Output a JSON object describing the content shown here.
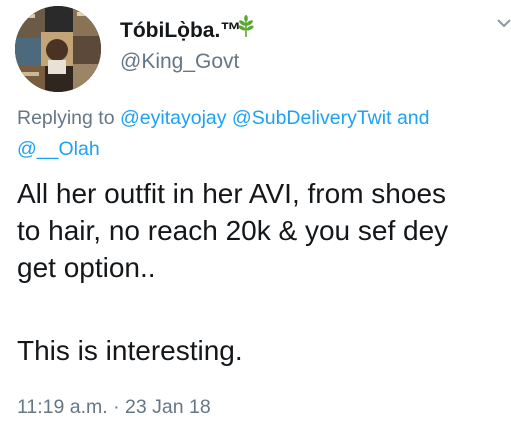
{
  "author": {
    "display_name": "TóbiLọ̀ba.™",
    "handle": "@King_Govt",
    "name_icon": "leaf-icon"
  },
  "reply": {
    "prefix": "Replying to",
    "mentions": [
      "@eyitayojay",
      "@SubDeliveryTwit",
      "@__Olah"
    ],
    "conjunction": "and"
  },
  "tweet": {
    "lines": [
      "All her outfit in her AVI, from shoes",
      "to hair, no reach 20k & you sef dey",
      "get option..",
      "This is interesting."
    ]
  },
  "meta": {
    "time": "11:19 a.m.",
    "separator": "·",
    "date": "23 Jan 18"
  },
  "icons": {
    "menu": "chevron-down-icon",
    "avatar": "avatar"
  },
  "colors": {
    "text": "#14171a",
    "secondary": "#657786",
    "link": "#1da1f2",
    "leaf": "#5aa832"
  }
}
